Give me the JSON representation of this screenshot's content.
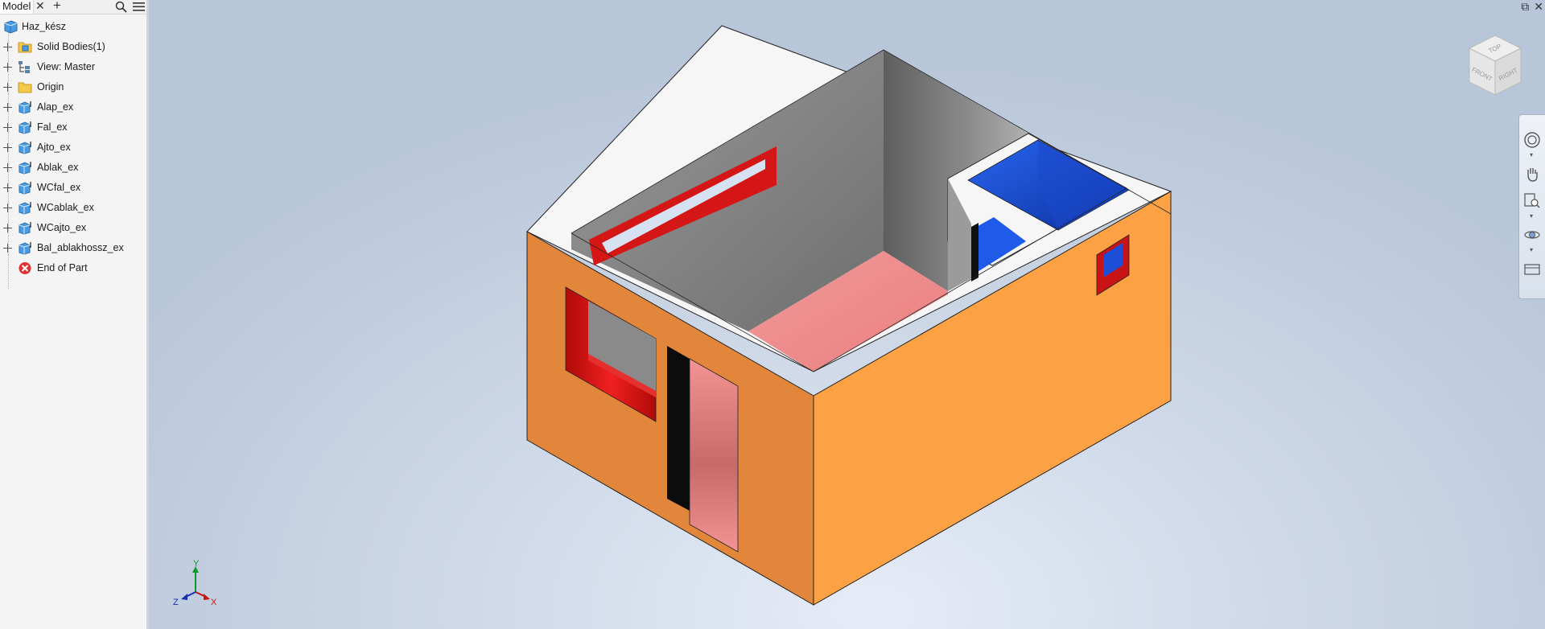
{
  "browser": {
    "tab_label": "Model",
    "tree": {
      "root": "Haz_kész",
      "items": [
        {
          "label": "Solid Bodies(1)",
          "icon": "folder-bodies-icon"
        },
        {
          "label": "View: Master",
          "icon": "view-rep-icon"
        },
        {
          "label": "Origin",
          "icon": "folder-icon"
        },
        {
          "label": "Alap_ex",
          "icon": "extrude-feature-icon"
        },
        {
          "label": "Fal_ex",
          "icon": "extrude-feature-icon"
        },
        {
          "label": "Ajto_ex",
          "icon": "extrude-feature-icon"
        },
        {
          "label": "Ablak_ex",
          "icon": "extrude-feature-icon"
        },
        {
          "label": "WCfal_ex",
          "icon": "extrude-feature-icon"
        },
        {
          "label": "WCablak_ex",
          "icon": "extrude-feature-icon"
        },
        {
          "label": "WCajto_ex",
          "icon": "extrude-feature-icon"
        },
        {
          "label": "Bal_ablakhossz_ex",
          "icon": "extrude-feature-icon"
        }
      ],
      "end": "End of Part"
    }
  },
  "viewcube": {
    "top": "TOP",
    "front": "FRONT",
    "right": "RIGHT"
  },
  "triad": {
    "x": "X",
    "y": "Y",
    "z": "Z"
  },
  "colors": {
    "wall_left": "#e2873c",
    "wall_right": "#fda244",
    "wall_top": "#f7f7f7",
    "interior_gray": "#8a8a8a",
    "floor": "#f08a8a",
    "frame_red": "#d81818",
    "wc_blue": "#1a4fd8",
    "viewport_bg": "#cfd9e8"
  }
}
